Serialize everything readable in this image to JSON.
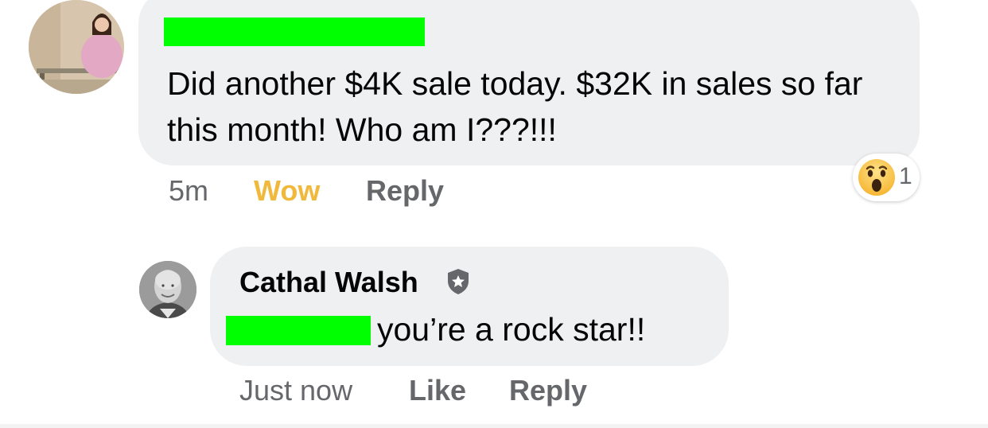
{
  "comment_1": {
    "text": "Did another $4K sale today. $32K in sales so far this month! Who am I???!!!",
    "timestamp": "5m",
    "reaction_label": "Wow",
    "reply_label": "Reply",
    "reaction_icon": "wow-emoji-icon",
    "reaction_count": "1",
    "author_redaction_color": "#00ff00"
  },
  "comment_2": {
    "author": "Cathal Walsh",
    "author_badge_icon": "top-contributor-star-badge-icon",
    "text": "you’re a rock star!!",
    "timestamp": "Just now",
    "like_label": "Like",
    "reply_label": "Reply",
    "mention_redaction_color": "#00ff00"
  },
  "colors": {
    "bubble": "#eff0f2",
    "meta_text": "#65676b",
    "wow_accent": "#f0b93b",
    "primary_text": "#050505"
  }
}
